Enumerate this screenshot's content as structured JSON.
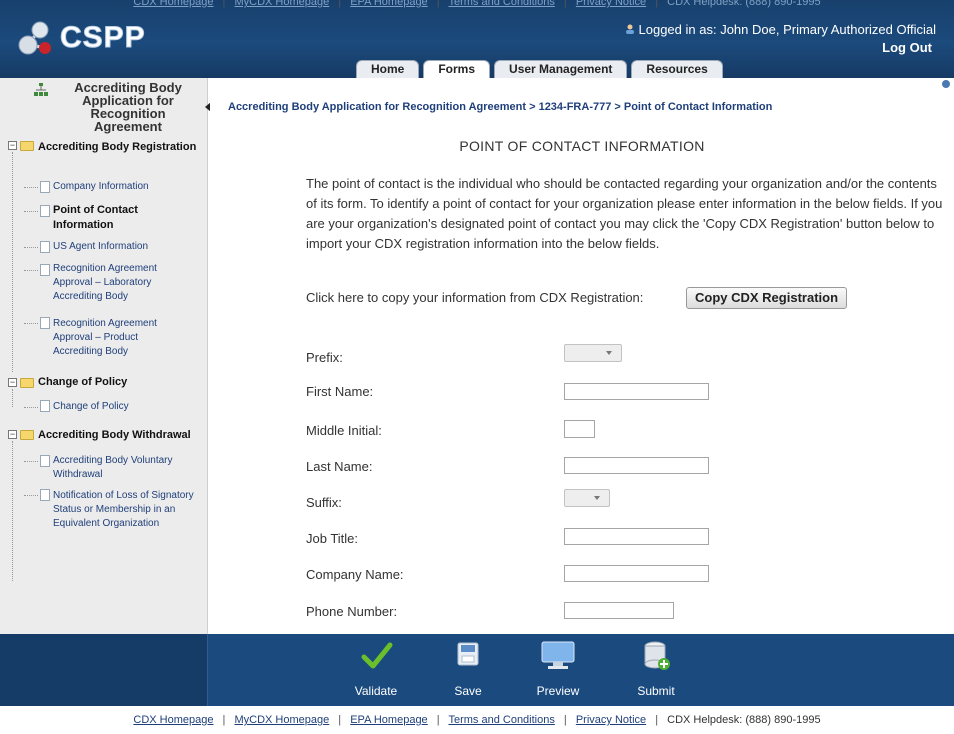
{
  "top_links": {
    "items": [
      "CDX Homepage",
      "MyCDX Homepage",
      "EPA Homepage",
      "Terms and Conditions",
      "Privacy Notice"
    ],
    "helpdesk": "CDX Helpdesk: (888) 890-1995"
  },
  "header": {
    "logo_text": "CSPP",
    "logged_in": "Logged in as: John Doe, Primary Authorized Official",
    "logout": "Log Out"
  },
  "tabs": [
    {
      "label": "Home",
      "active": false
    },
    {
      "label": "Forms",
      "active": true
    },
    {
      "label": "User Management",
      "active": false
    },
    {
      "label": "Resources",
      "active": false
    }
  ],
  "sidebar": {
    "title": "Accrediting Body Application for Recognition Agreement",
    "sections": [
      {
        "label": "Accrediting Body Registration",
        "items": [
          {
            "label": "Company Information",
            "active": false
          },
          {
            "label": "Point of Contact Information",
            "active": true
          },
          {
            "label": "US Agent Information",
            "active": false
          },
          {
            "label": "Recognition Agreement Approval – Laboratory Accrediting Body",
            "active": false
          },
          {
            "label": "Recognition Agreement Approval – Product Accrediting Body",
            "active": false
          }
        ]
      },
      {
        "label": "Change of Policy",
        "items": [
          {
            "label": "Change of Policy",
            "active": false
          }
        ]
      },
      {
        "label": "Accrediting Body Withdrawal",
        "items": [
          {
            "label": "Accrediting Body Voluntary Withdrawal",
            "active": false
          },
          {
            "label": "Notification of Loss of Signatory Status or Membership in an Equivalent Organization",
            "active": false
          }
        ]
      }
    ]
  },
  "main": {
    "breadcrumb": "Accrediting Body Application for Recognition Agreement > 1234-FRA-777 > Point of Contact Information",
    "title": "POINT OF CONTACT INFORMATION",
    "intro": "The point of contact is the individual who should be contacted regarding your organization and/or the contents of its form. To identify a point of contact for your organization please enter information in the below fields. If you are your organization's designated point of contact you may click the 'Copy CDX Registration' button below to import your CDX registration information into the below fields.",
    "copy_label": "Click here to copy your information from CDX Registration:",
    "copy_button": "Copy CDX Registration",
    "fields": [
      {
        "label": "Prefix:",
        "type": "select",
        "value": ""
      },
      {
        "label": "First Name:",
        "type": "text",
        "value": ""
      },
      {
        "label": "Middle Initial:",
        "type": "text",
        "value": ""
      },
      {
        "label": "Last Name:",
        "type": "text",
        "value": ""
      },
      {
        "label": "Suffix:",
        "type": "select",
        "value": ""
      },
      {
        "label": "Job Title:",
        "type": "text",
        "value": ""
      },
      {
        "label": "Company Name:",
        "type": "text",
        "value": ""
      },
      {
        "label": "Phone Number:",
        "type": "text",
        "value": ""
      }
    ]
  },
  "actions": [
    {
      "label": "Validate",
      "icon": "checkmark-icon"
    },
    {
      "label": "Save",
      "icon": "floppy-disk-icon"
    },
    {
      "label": "Preview",
      "icon": "monitor-icon"
    },
    {
      "label": "Submit",
      "icon": "database-add-icon"
    }
  ],
  "footer": {
    "links": [
      "CDX Homepage",
      "MyCDX Homepage",
      "EPA Homepage",
      "Terms and Conditions",
      "Privacy Notice"
    ],
    "helpdesk": "CDX Helpdesk: (888) 890-1995"
  },
  "colors": {
    "header_blue": "#1b4a7c",
    "link_blue": "#1f3f7a",
    "sidebar_gray": "#ececec",
    "checkmark_green": "#6bbf2a"
  }
}
